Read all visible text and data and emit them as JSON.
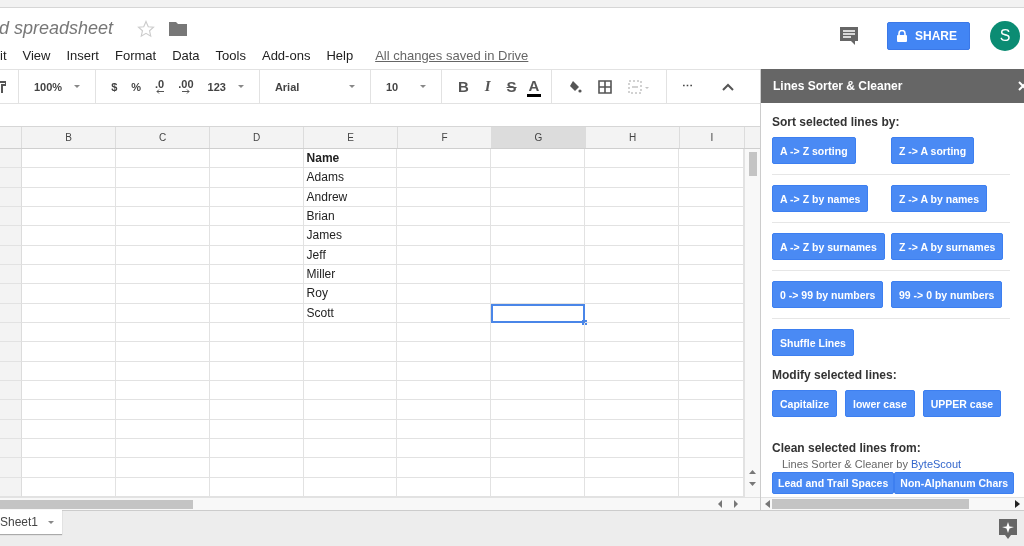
{
  "document": {
    "title": "d spreadsheet",
    "starred": false
  },
  "menu": [
    {
      "label": "it"
    },
    {
      "label": "View"
    },
    {
      "label": "Insert"
    },
    {
      "label": "Format"
    },
    {
      "label": "Data"
    },
    {
      "label": "Tools"
    },
    {
      "label": "Add-ons"
    },
    {
      "label": "Help"
    }
  ],
  "save_status": "All changes saved in Drive",
  "share_button": "SHARE",
  "avatar": {
    "initial": "S",
    "color": "#0b8c73"
  },
  "toolbar": {
    "zoom": "100%",
    "currency": "$",
    "percent": "%",
    "decrease_decimals": ".0",
    "increase_decimals": ".00",
    "number_format": "123",
    "font": "Arial",
    "font_size": "10",
    "bold": "B",
    "italic": "I",
    "strikethrough": "S",
    "text_color": "A",
    "merge_disabled": true,
    "more": "⋯"
  },
  "table": {
    "columns": [
      {
        "label": "B",
        "selected": false
      },
      {
        "label": "C",
        "selected": false
      },
      {
        "label": "D",
        "selected": false
      },
      {
        "label": "E",
        "selected": false
      },
      {
        "label": "F",
        "selected": false
      },
      {
        "label": "G",
        "selected": true
      },
      {
        "label": "H",
        "selected": false
      },
      {
        "label": "I",
        "selected": false
      }
    ],
    "rows": [
      {
        "column_e": "Name",
        "bold": true,
        "column_g_selected": false
      },
      {
        "column_e": "Adams",
        "bold": false,
        "column_g_selected": false
      },
      {
        "column_e": "Andrew",
        "bold": false,
        "column_g_selected": false
      },
      {
        "column_e": "Brian",
        "bold": false,
        "column_g_selected": false
      },
      {
        "column_e": "James",
        "bold": false,
        "column_g_selected": false
      },
      {
        "column_e": "Jeff",
        "bold": false,
        "column_g_selected": false
      },
      {
        "column_e": "Miller",
        "bold": false,
        "column_g_selected": false
      },
      {
        "column_e": "Roy",
        "bold": false,
        "column_g_selected": false
      },
      {
        "column_e": "Scott",
        "bold": false,
        "column_g_selected": true
      }
    ]
  },
  "sheet_tabs": [
    {
      "label": "Sheet1",
      "selected": true
    }
  ],
  "sidebar": {
    "title": "Lines Sorter & Cleaner",
    "sections": [
      {
        "heading": "Sort selected lines by:",
        "groups": [
          {
            "buttons": [
              "A -> Z sorting",
              "Z -> A sorting"
            ],
            "divider": true
          },
          {
            "buttons": [
              "A -> Z by names",
              "Z -> A by names"
            ],
            "divider": true
          },
          {
            "buttons": [
              "A -> Z by surnames",
              "Z -> A by surnames"
            ],
            "divider": true
          },
          {
            "buttons": [
              "0 -> 99 by numbers",
              "99 -> 0 by numbers"
            ],
            "divider": true
          },
          {
            "buttons": [
              "Shuffle Lines"
            ],
            "divider": false
          }
        ]
      },
      {
        "heading": "Modify selected lines:",
        "groups": [
          {
            "buttons": [
              "Capitalize",
              "lower case",
              "UPPER case"
            ],
            "divider": false
          }
        ]
      },
      {
        "heading": "Clean selected lines from:",
        "groups": [
          {
            "buttons": [
              "Lead and Trail Spaces",
              "Non-Alphanum Chars"
            ],
            "divider": false
          }
        ]
      }
    ],
    "footer": {
      "text": "Lines Sorter & Cleaner by",
      "link": "ByteScout"
    }
  }
}
